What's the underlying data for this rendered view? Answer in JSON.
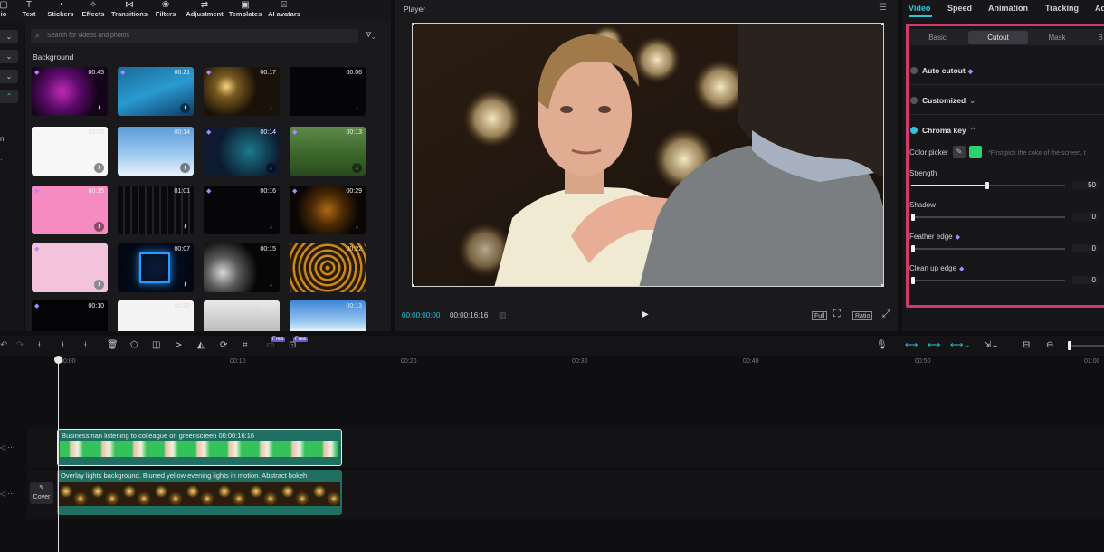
{
  "toolbar": {
    "items": [
      {
        "label": "io",
        "icon": "media-icon"
      },
      {
        "label": "Text",
        "icon": "text-icon"
      },
      {
        "label": "Stickers",
        "icon": "stickers-icon"
      },
      {
        "label": "Effects",
        "icon": "effects-icon"
      },
      {
        "label": "Transitions",
        "icon": "transitions-icon"
      },
      {
        "label": "Filters",
        "icon": "filters-icon"
      },
      {
        "label": "Adjustment",
        "icon": "adjustment-icon"
      },
      {
        "label": "Templates",
        "icon": "templates-icon"
      },
      {
        "label": "AI avatars",
        "icon": "ai-avatars-icon"
      }
    ]
  },
  "leftcol": {
    "labels": [
      "n"
    ]
  },
  "media": {
    "search_placeholder": "Search for videos and photos",
    "section_title": "Background",
    "thumbs": [
      {
        "dur": "00:45"
      },
      {
        "dur": "00:21"
      },
      {
        "dur": "00:17"
      },
      {
        "dur": "00:06"
      },
      {
        "dur": "00:06"
      },
      {
        "dur": "00:14"
      },
      {
        "dur": "00:14"
      },
      {
        "dur": "00:13"
      },
      {
        "dur": "00:15"
      },
      {
        "dur": "01:01"
      },
      {
        "dur": "00:16"
      },
      {
        "dur": "00:29"
      },
      {
        "dur": "00:05"
      },
      {
        "dur": "00:07"
      },
      {
        "dur": "00:15"
      },
      {
        "dur": "00:22"
      },
      {
        "dur": "00:10"
      },
      {
        "dur": "00:20"
      },
      {
        "dur": "00:30"
      },
      {
        "dur": "00:13"
      }
    ]
  },
  "player": {
    "title": "Player",
    "time_current": "00:00:00:00",
    "time_total": "00:00:16:16",
    "full_label": "Full",
    "ratio_label": "Ratio"
  },
  "right_panel": {
    "tabs": [
      "Video",
      "Speed",
      "Animation",
      "Tracking",
      "Ad"
    ],
    "subtabs": [
      "Basic",
      "Cutout",
      "Mask",
      "B"
    ],
    "auto_cutout": "Auto cutout",
    "customized": "Customized",
    "chroma_key": "Chroma key",
    "color_picker": "Color picker",
    "picker_note": "*First pick the color of the screen, t",
    "swatch_color": "#2fcf6a",
    "strength_label": "Strength",
    "strength_value": "50",
    "shadow_label": "Shadow",
    "shadow_value": "0",
    "feather_label": "Feather edge",
    "feather_value": "0",
    "cleanup_label": "Clean up edge",
    "cleanup_value": "0"
  },
  "timeline": {
    "badges": [
      "Free",
      "Free"
    ],
    "ruler": [
      "00:00",
      "00:10",
      "00:20",
      "00:30",
      "00:40",
      "00:50",
      "01:00"
    ],
    "clip1_title": "Businessman listening to  colleague on greenscreen  00:00:16:16",
    "clip2_title": "Overlay lights background. Blurred yellow evening lights in motion.  Abstract bokeh",
    "cover_label": "Cover"
  }
}
